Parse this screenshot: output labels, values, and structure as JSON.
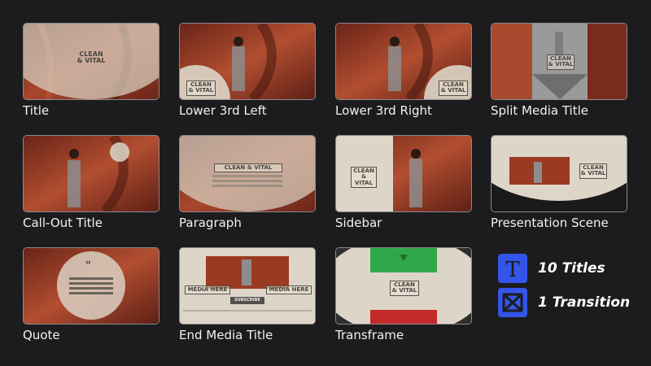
{
  "thumbnails": [
    {
      "label": "Title",
      "title_text": [
        "CLEAN",
        "& VITAL"
      ]
    },
    {
      "label": "Lower 3rd Left",
      "title_text": [
        "CLEAN",
        "& VITAL"
      ]
    },
    {
      "label": "Lower 3rd Right",
      "title_text": [
        "CLEAN",
        "& VITAL"
      ]
    },
    {
      "label": "Split Media Title",
      "title_text": [
        "CLEAN",
        "& VITAL"
      ]
    },
    {
      "label": "Call-Out Title",
      "title_text": [
        "CLEAN",
        "& VITAL"
      ]
    },
    {
      "label": "Paragraph",
      "title_text": [
        "CLEAN & VITAL"
      ]
    },
    {
      "label": "Sidebar",
      "title_text": [
        "CLEAN",
        "& VITAL"
      ]
    },
    {
      "label": "Presentation Scene",
      "title_text": [
        "CLEAN",
        "& VITAL"
      ]
    },
    {
      "label": "Quote",
      "title_text": [
        "“"
      ]
    },
    {
      "label": "End Media Title",
      "title_text": [
        "MEDIA HERE",
        "MEDIA HERE",
        "SUBSCRIBE"
      ]
    },
    {
      "label": "Transframe",
      "title_text": [
        "CLEAN",
        "& VITAL"
      ]
    }
  ],
  "legend": {
    "titles": {
      "text": "10 Titles",
      "icon": "title-t-icon"
    },
    "transitions": {
      "text": "1 Transition",
      "icon": "transition-bowtie-icon"
    }
  },
  "colors": {
    "background": "#1c1c1e",
    "legend_icon": "#3355e8",
    "canyon": "#7a2e1f",
    "overlay": "#e8e2d6"
  }
}
